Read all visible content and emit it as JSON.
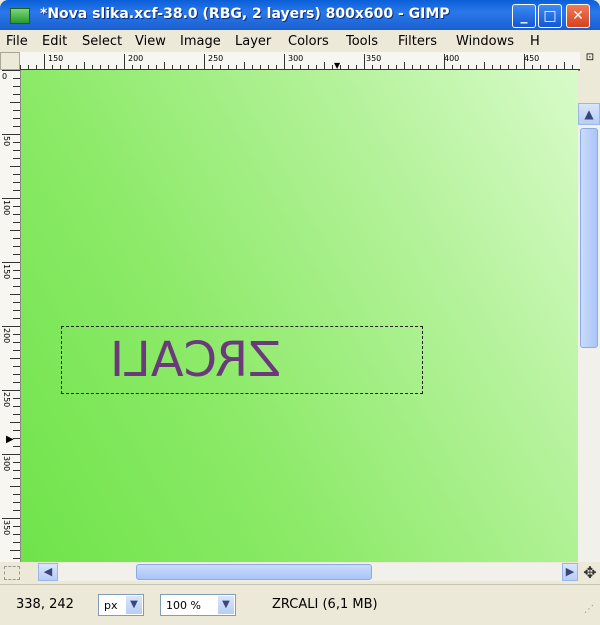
{
  "window": {
    "title": "*Nova slika.xcf-38.0 (RBG, 2 layers) 800x600 - GIMP",
    "min_glyph": "_",
    "max_glyph": "□",
    "close_glyph": "✕"
  },
  "menu": [
    {
      "label": "File"
    },
    {
      "label": "Edit"
    },
    {
      "label": "Select"
    },
    {
      "label": "View"
    },
    {
      "label": "Image"
    },
    {
      "label": "Layer"
    },
    {
      "label": "Colors"
    },
    {
      "label": "Tools"
    },
    {
      "label": "Filters"
    },
    {
      "label": "Windows"
    },
    {
      "label": "H"
    }
  ],
  "ruler_h": {
    "labels": [
      "150",
      "200",
      "250",
      "300",
      "350",
      "400",
      "450"
    ]
  },
  "ruler_v": {
    "labels": [
      "0",
      "50",
      "100",
      "150",
      "200",
      "250",
      "300",
      "350"
    ]
  },
  "canvas": {
    "text": "ZRCALI",
    "text_color": "#6a3a7a",
    "gradient_start": "#6fe34a",
    "gradient_end": "#d8fbc9"
  },
  "scroll": {
    "up": "▲",
    "down": "▼",
    "left": "◀",
    "right": "▶"
  },
  "status": {
    "coords": "338, 242",
    "unit": "px",
    "zoom": "100 %",
    "message": "ZRCALI (6,1 MB)"
  },
  "icons": {
    "app": "gimp-app-icon",
    "navigate": "✥"
  }
}
